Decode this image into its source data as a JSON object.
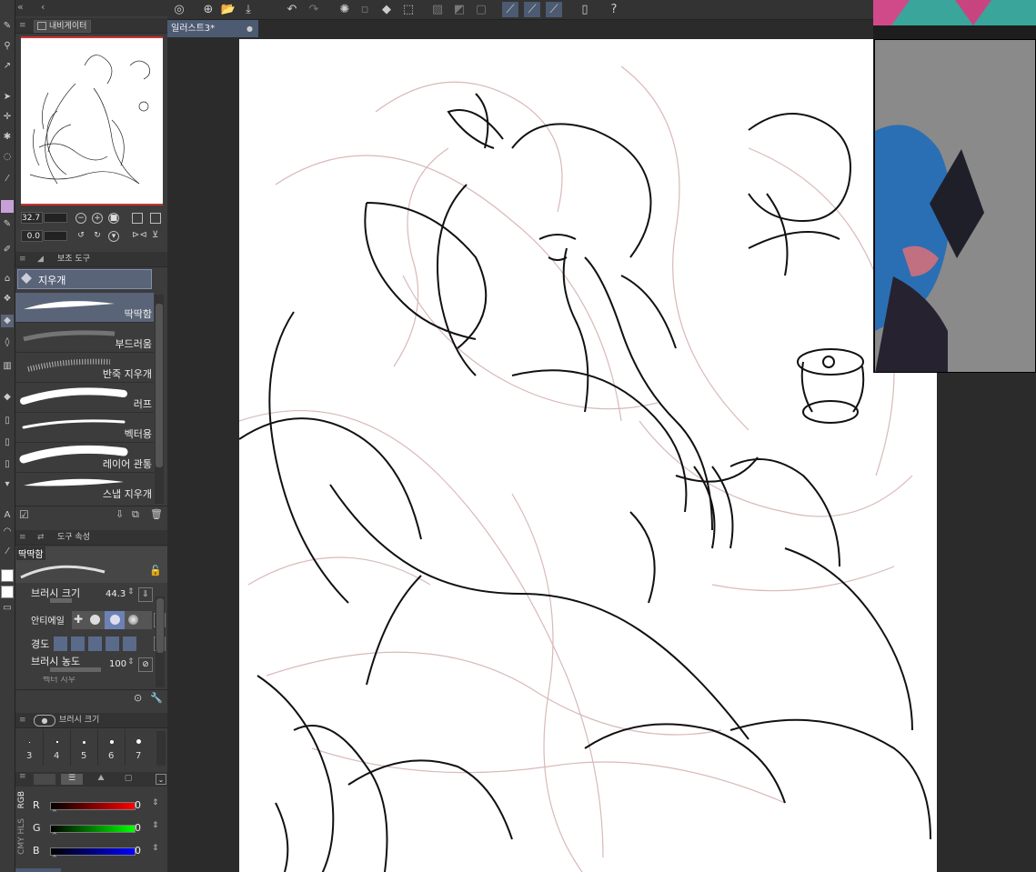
{
  "toolbar": {
    "icons": [
      "app-menu-icon",
      "new-file-icon",
      "open-folder-icon",
      "export-icon",
      "undo-icon",
      "redo-icon",
      "loading-icon",
      "clear-icon",
      "fill-icon",
      "transform-icon",
      "grid-icon",
      "ruler-icon",
      "frame-icon",
      "snap-ruler-icon",
      "snap-special-icon",
      "snap-grid-icon",
      "smartphone-icon",
      "help-icon"
    ]
  },
  "document": {
    "tab_label": "일러스트3*"
  },
  "navigator": {
    "title": "내비게이터",
    "zoom_value": "32.7",
    "rotation_value": "0.0"
  },
  "subtool": {
    "title": "보조 도구",
    "group_label": "지우개",
    "items": [
      {
        "label": "딱딱함",
        "selected": true
      },
      {
        "label": "부드러움",
        "selected": false
      },
      {
        "label": "반죽 지우개",
        "selected": false
      },
      {
        "label": "러프",
        "selected": false
      },
      {
        "label": "벡터용",
        "selected": false
      },
      {
        "label": "레이어 관통",
        "selected": false
      },
      {
        "label": "스냅 지우개",
        "selected": false
      }
    ]
  },
  "tool_property": {
    "title": "도구 속성",
    "preset_name": "딱딱함",
    "brush_size_label": "브러시 크기",
    "brush_size_value": "44.3",
    "antialias_label": "안티에일",
    "hardness_label": "경도",
    "density_label": "브러시 농도",
    "density_value": "100",
    "cut_label": "벡터 지우"
  },
  "brush_size_panel": {
    "title": "브러시 크기",
    "sizes": [
      "3",
      "4",
      "5",
      "6",
      "7"
    ]
  },
  "color_panel": {
    "side_label": "RGB",
    "side_label2": "CMY HLS",
    "channels": [
      {
        "name": "R",
        "value": "0",
        "color": "#ff0000"
      },
      {
        "name": "G",
        "value": "0",
        "color": "#00ff00"
      },
      {
        "name": "B",
        "value": "0",
        "color": "#0000ff"
      }
    ]
  }
}
